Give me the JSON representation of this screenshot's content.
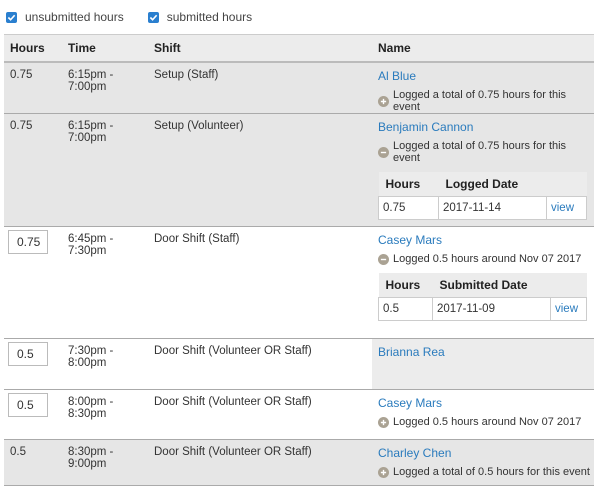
{
  "filters": [
    {
      "label": "unsubmitted hours",
      "checked": true
    },
    {
      "label": "submitted hours",
      "checked": true
    }
  ],
  "columns": {
    "hours": "Hours",
    "time": "Time",
    "shift": "Shift",
    "name": "Name"
  },
  "rows": [
    {
      "hours": "0.75",
      "time_start": "6:15pm -",
      "time_end": "7:00pm",
      "shift": "Setup (Staff)",
      "name": "Al Blue",
      "note": "Logged a total of 0.75 hours for this event"
    },
    {
      "hours": "0.75",
      "time_start": "6:15pm -",
      "time_end": "7:00pm",
      "shift": "Setup (Volunteer)",
      "name": "Benjamin Cannon",
      "note": "Logged a total of 0.75 hours for this event",
      "sub": {
        "col1": "Hours",
        "col2": "Logged Date",
        "hours": "0.75",
        "date": "2017-11-14",
        "link": "view"
      }
    },
    {
      "hours": "0.75",
      "time_start": "6:45pm -",
      "time_end": "7:30pm",
      "shift": "Door Shift (Staff)",
      "name": "Casey Mars",
      "note": "Logged 0.5 hours around Nov 07 2017",
      "sub": {
        "col1": "Hours",
        "col2": "Submitted Date",
        "hours": "0.5",
        "date": "2017-11-09",
        "link": "view"
      }
    },
    {
      "hours": "0.5",
      "time_start": "7:30pm -",
      "time_end": "8:00pm",
      "shift": "Door Shift (Volunteer OR Staff)",
      "name": "Brianna Rea"
    },
    {
      "hours": "0.5",
      "time_start": "8:00pm -",
      "time_end": "8:30pm",
      "shift": "Door Shift (Volunteer OR Staff)",
      "name": "Casey Mars",
      "note": "Logged 0.5 hours around Nov 07 2017"
    },
    {
      "hours": "0.5",
      "time_start": "8:30pm -",
      "time_end": "9:00pm",
      "shift": "Door Shift (Volunteer OR Staff)",
      "name": "Charley Chen",
      "note": "Logged a total of 0.5 hours for this event"
    }
  ],
  "colors": {
    "link": "#2a7bbd",
    "checkbox": "#2a7fcf",
    "row_grey": "#e6e6e6"
  }
}
